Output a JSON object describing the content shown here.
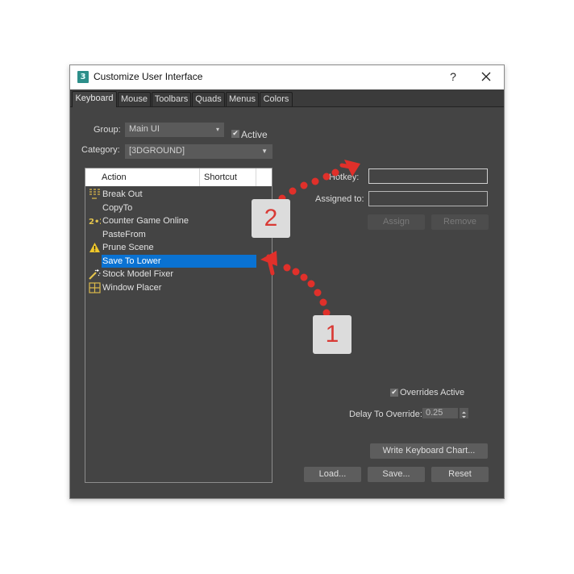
{
  "window": {
    "title": "Customize User Interface",
    "app_icon_glyph": "3",
    "help_label": "?",
    "close_icon": "close-icon"
  },
  "tabs": [
    {
      "label": "Keyboard",
      "active": true
    },
    {
      "label": "Mouse",
      "active": false
    },
    {
      "label": "Toolbars",
      "active": false
    },
    {
      "label": "Quads",
      "active": false
    },
    {
      "label": "Menus",
      "active": false
    },
    {
      "label": "Colors",
      "active": false
    }
  ],
  "filters": {
    "group_label": "Group:",
    "group_value": "Main UI",
    "active_label": "Active",
    "active_checked": true,
    "category_label": "Category:",
    "category_value": "[3DGROUND]"
  },
  "action_list": {
    "columns": [
      "Action",
      "Shortcut"
    ],
    "items": [
      {
        "label": "Break Out",
        "icon": "bars-icon",
        "selected": false
      },
      {
        "label": "CopyTo",
        "icon": "",
        "selected": false
      },
      {
        "label": "Counter Game Online",
        "icon": "counter-2-2-icon",
        "selected": false
      },
      {
        "label": "PasteFrom",
        "icon": "",
        "selected": false
      },
      {
        "label": "Prune Scene",
        "icon": "warning-icon",
        "selected": false
      },
      {
        "label": "Save To Lower",
        "icon": "",
        "selected": true
      },
      {
        "label": "Stock Model Fixer",
        "icon": "magic-wand-icon",
        "selected": false
      },
      {
        "label": "Window Placer",
        "icon": "grid-icon",
        "selected": false
      }
    ]
  },
  "hotkey_panel": {
    "hotkey_label": "Hotkey:",
    "hotkey_value": "",
    "assigned_label": "Assigned to:",
    "assigned_value": "",
    "assign_button": "Assign",
    "remove_button": "Remove"
  },
  "overrides": {
    "overrides_active_label": "Overrides Active",
    "overrides_active_checked": true,
    "delay_label": "Delay To Override:",
    "delay_value": "0.25"
  },
  "buttons": {
    "write_chart": "Write Keyboard Chart...",
    "load": "Load...",
    "save": "Save...",
    "reset": "Reset"
  },
  "annotations": [
    {
      "number": "1",
      "points_to": "Save To Lower"
    },
    {
      "number": "2",
      "points_to": "Hotkey field"
    }
  ],
  "colors": {
    "selection": "#0a72d2",
    "annotation_red": "#d93a35",
    "dialog_bg": "#444444"
  }
}
